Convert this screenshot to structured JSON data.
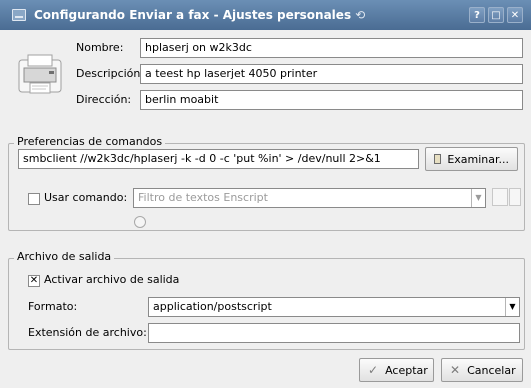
{
  "window": {
    "title": "Configurando Enviar a fax - Ajustes personales",
    "title_swirl": "⟲",
    "buttons": [
      "?",
      "□",
      "✕"
    ]
  },
  "header": {
    "nombre_label": "Nombre:",
    "nombre_value": "hplaserj on w2k3dc",
    "descripcion_label": "Descripción:",
    "descripcion_value": "a teest hp laserjet 4050 printer",
    "direccion_label": "Dirección:",
    "direccion_value": "berlin moabit"
  },
  "commands": {
    "group_title": "Preferencias de comandos",
    "command_value": "smbclient //w2k3dc/hplaserj -k -d 0 -c 'put %in' > /dev/null 2>&1",
    "browse_label": "Examinar...",
    "use_command_label": "Usar comando:",
    "filter_value": "Filtro de textos Enscript",
    "use_command_checked": false
  },
  "output": {
    "group_title": "Archivo de salida",
    "activate_label": "Activar archivo de salida",
    "activate_checked": true,
    "format_label": "Formato:",
    "format_value": "application/postscript",
    "extension_label": "Extensión de archivo:",
    "extension_value": ""
  },
  "footer": {
    "accept_label": "Aceptar",
    "cancel_label": "Cancelar"
  },
  "icons": {
    "window": "window-icon",
    "printer": "printer-icon",
    "browse": "folder-icon",
    "doc": "document-icon",
    "wrench": "wrench-icon",
    "help": "help-icon",
    "accept": "checkmark-icon",
    "cancel": "cross-icon"
  },
  "colors": {
    "title_top": "#6b8fb5",
    "title_bottom": "#4a6c93",
    "window_bg": "#efefef"
  }
}
